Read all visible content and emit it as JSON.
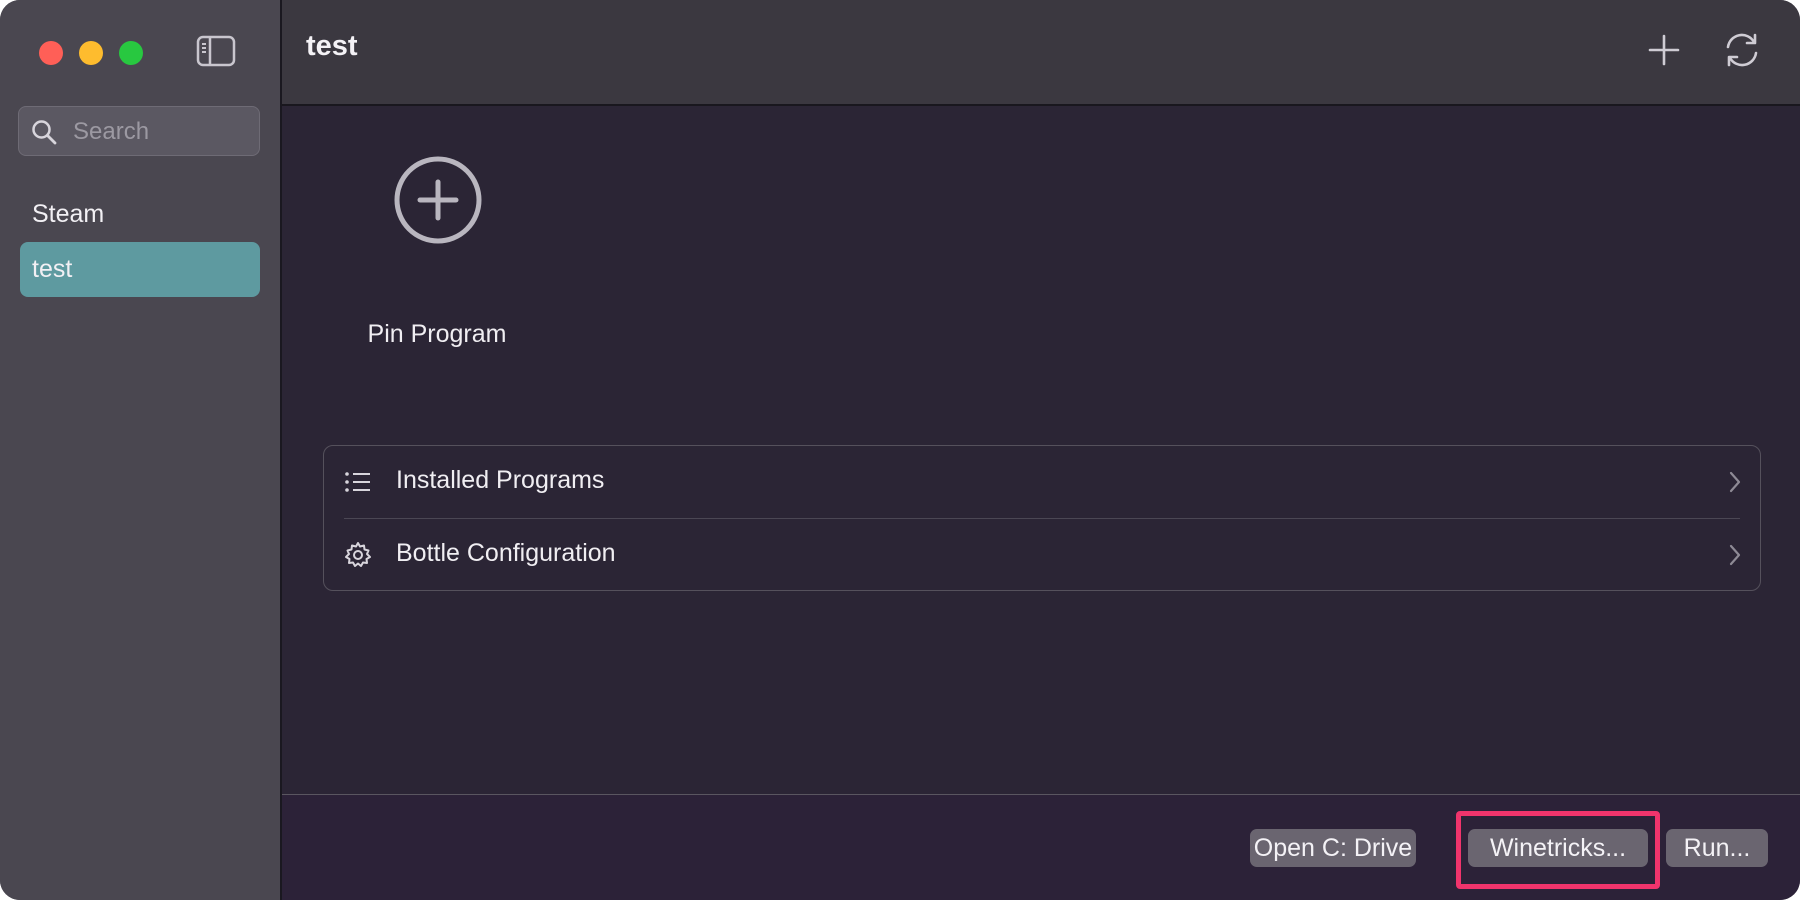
{
  "sidebar": {
    "search": {
      "placeholder": "Search",
      "value": ""
    },
    "items": [
      {
        "label": "Steam",
        "selected": false
      },
      {
        "label": "test",
        "selected": true
      }
    ],
    "selected_color": "#5e9aa0"
  },
  "header": {
    "title": "test",
    "icons": [
      "plus-icon",
      "refresh-icon"
    ]
  },
  "main": {
    "pin": {
      "label": "Pin Program",
      "icon": "plus-circle-icon"
    },
    "list": [
      {
        "label": "Installed Programs",
        "icon": "list-icon"
      },
      {
        "label": "Bottle Configuration",
        "icon": "gear-icon"
      }
    ]
  },
  "footer": {
    "buttons": [
      "Open C: Drive",
      "Winetricks...",
      "Run..."
    ],
    "highlight_color": "#f0346c"
  }
}
